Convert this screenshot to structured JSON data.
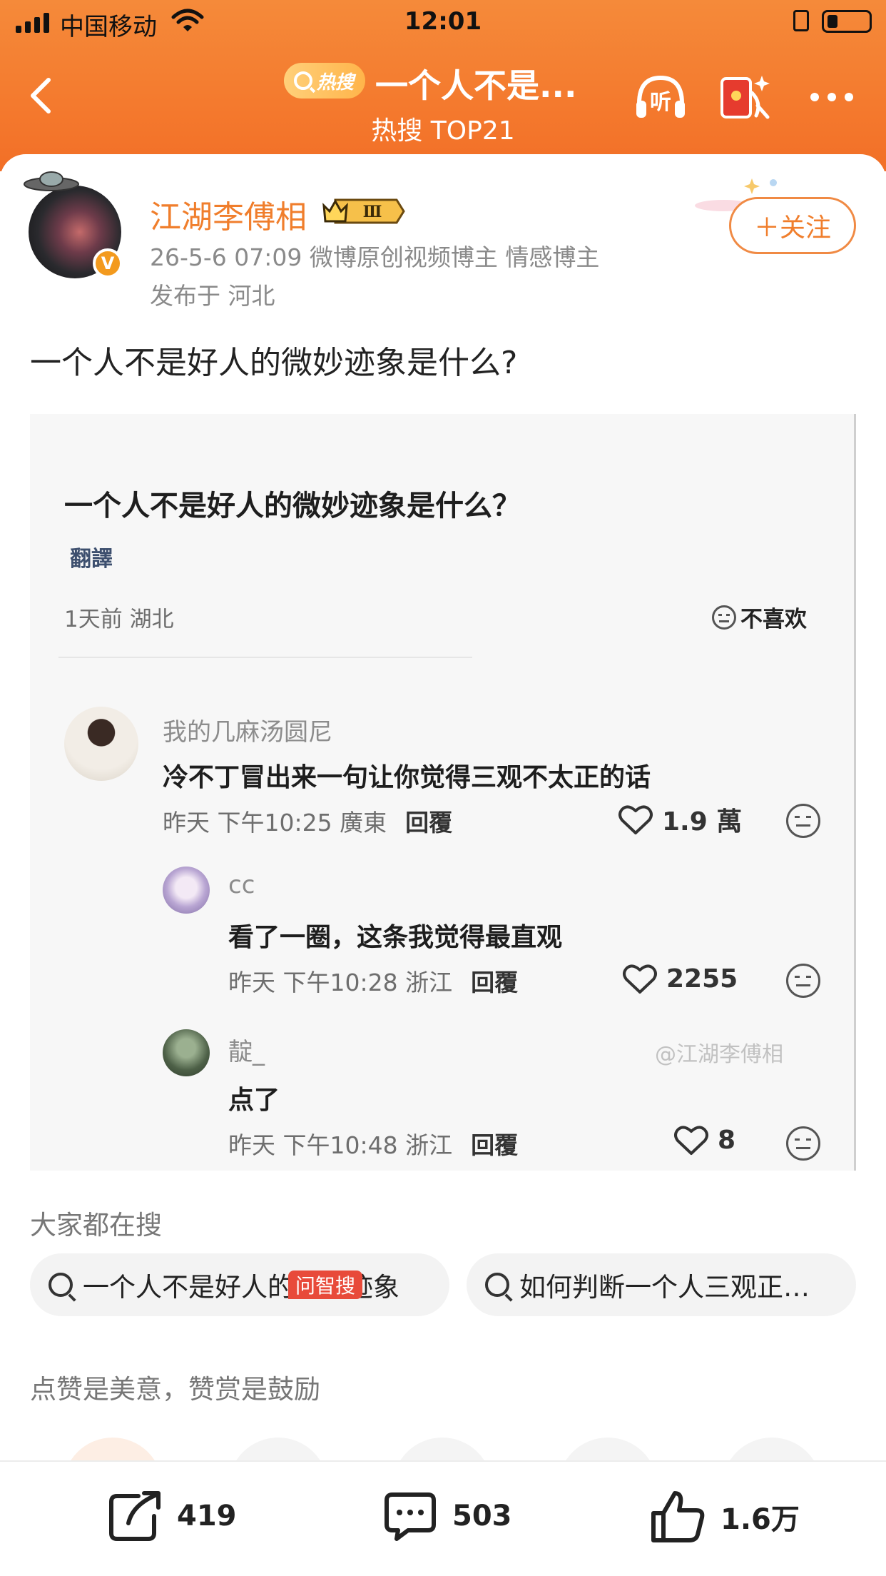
{
  "status_bar": {
    "carrier": "中国移动",
    "time": "12:01"
  },
  "nav": {
    "hot_badge": "热搜",
    "title": "一个人不是...",
    "subtitle": "热搜 TOP21",
    "listen_icon": "headphones-listen-icon",
    "redpack_icon": "red-packet-icon",
    "more_icon": "more-dots-icon"
  },
  "post": {
    "username": "江湖李傅相",
    "level_badge": "Ⅲ",
    "meta": "26-5-6 07:09  微博原创视频博主 情感博主",
    "location": "发布于 河北",
    "follow_label": "＋关注",
    "verify_mark": "V",
    "text": "一个人不是好人的微妙迹象是什么?"
  },
  "embedded": {
    "question": "一个人不是好人的微妙迹象是什么？",
    "translate": "翻譯",
    "time_loc": "1天前 湖北",
    "dislike_label": "不喜欢",
    "comments": [
      {
        "name": "我的几麻汤圆尼",
        "text": "冷不丁冒出来一句让你觉得三观不太正的话",
        "meta": "昨天 下午10:25 廣東",
        "reply": "回覆",
        "likes": "1.9 萬"
      },
      {
        "name": "cc",
        "text": "看了一圈，这条我觉得最直观",
        "meta": "昨天 下午10:28 浙江",
        "reply": "回覆",
        "likes": "2255"
      },
      {
        "name": "靛_",
        "text": "点了",
        "meta": "昨天 下午10:48 浙江",
        "reply": "回覆",
        "likes": "8"
      }
    ],
    "watermark": "@江湖李傅相"
  },
  "search": {
    "title": "大家都在搜",
    "chips": [
      "一个人不是好人的微妙迹象",
      "如何判断一个人三观正…"
    ]
  },
  "reward": {
    "title": "点赞是美意，赞赏是鼓励",
    "badge": "问智搜"
  },
  "bottom_bar": {
    "share_count": "419",
    "comment_count": "503",
    "like_count": "1.6万"
  },
  "colors": {
    "header": "#f47a2e",
    "accent": "#f07e2c"
  }
}
